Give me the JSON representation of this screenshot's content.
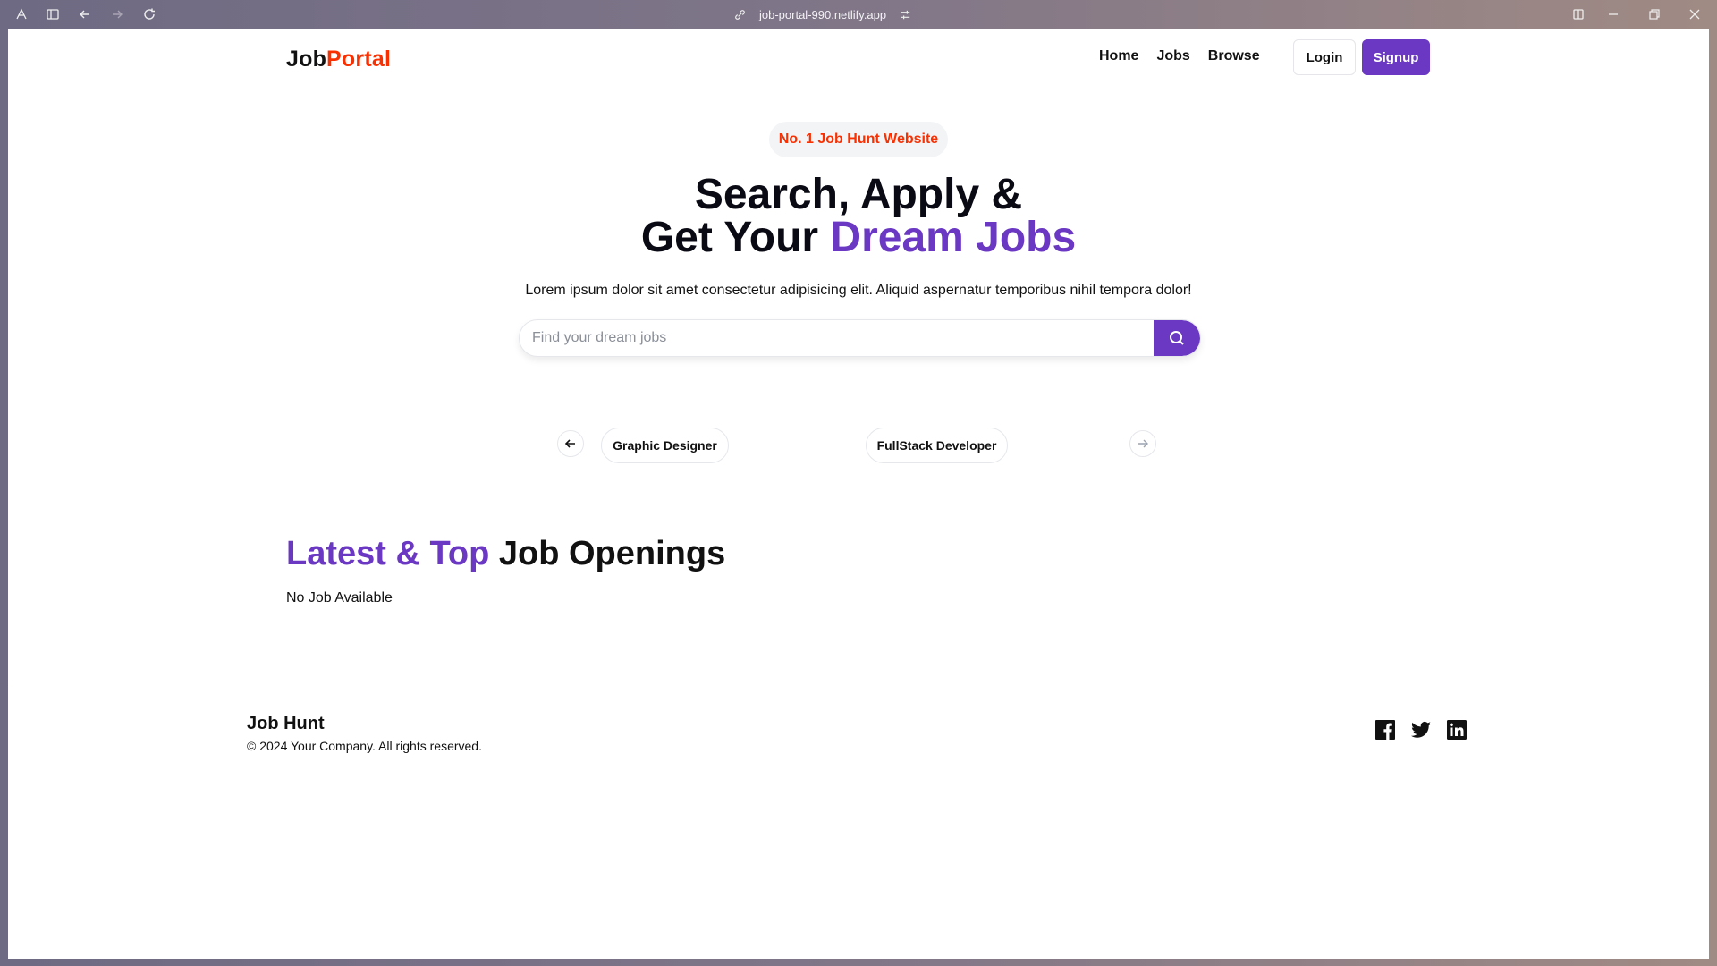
{
  "browser": {
    "url": "job-portal-990.netlify.app"
  },
  "nav": {
    "logo_main": "Job",
    "logo_accent": "Portal",
    "links": [
      "Home",
      "Jobs",
      "Browse"
    ],
    "login_label": "Login",
    "signup_label": "Signup"
  },
  "hero": {
    "badge": "No. 1 Job Hunt Website",
    "title_line1": "Search, Apply &",
    "title_line2_plain": "Get Your ",
    "title_line2_accent": "Dream Jobs",
    "subtitle": "Lorem ipsum dolor sit amet consectetur adipisicing elit. Aliquid aspernatur temporibus nihil tempora dolor!",
    "search_placeholder": "Find your dream jobs",
    "search_value": ""
  },
  "categories": {
    "items": [
      "Graphic Designer",
      "FullStack Developer"
    ]
  },
  "latest": {
    "title_accent": "Latest & Top",
    "title_plain": " Job Openings",
    "empty_text": "No Job Available"
  },
  "footer": {
    "brand": "Job Hunt",
    "copyright": "© 2024 Your Company. All rights reserved.",
    "social": [
      "facebook-icon",
      "twitter-icon",
      "linkedin-icon"
    ]
  },
  "colors": {
    "primary": "#6a38c2",
    "accent": "#f83002"
  }
}
